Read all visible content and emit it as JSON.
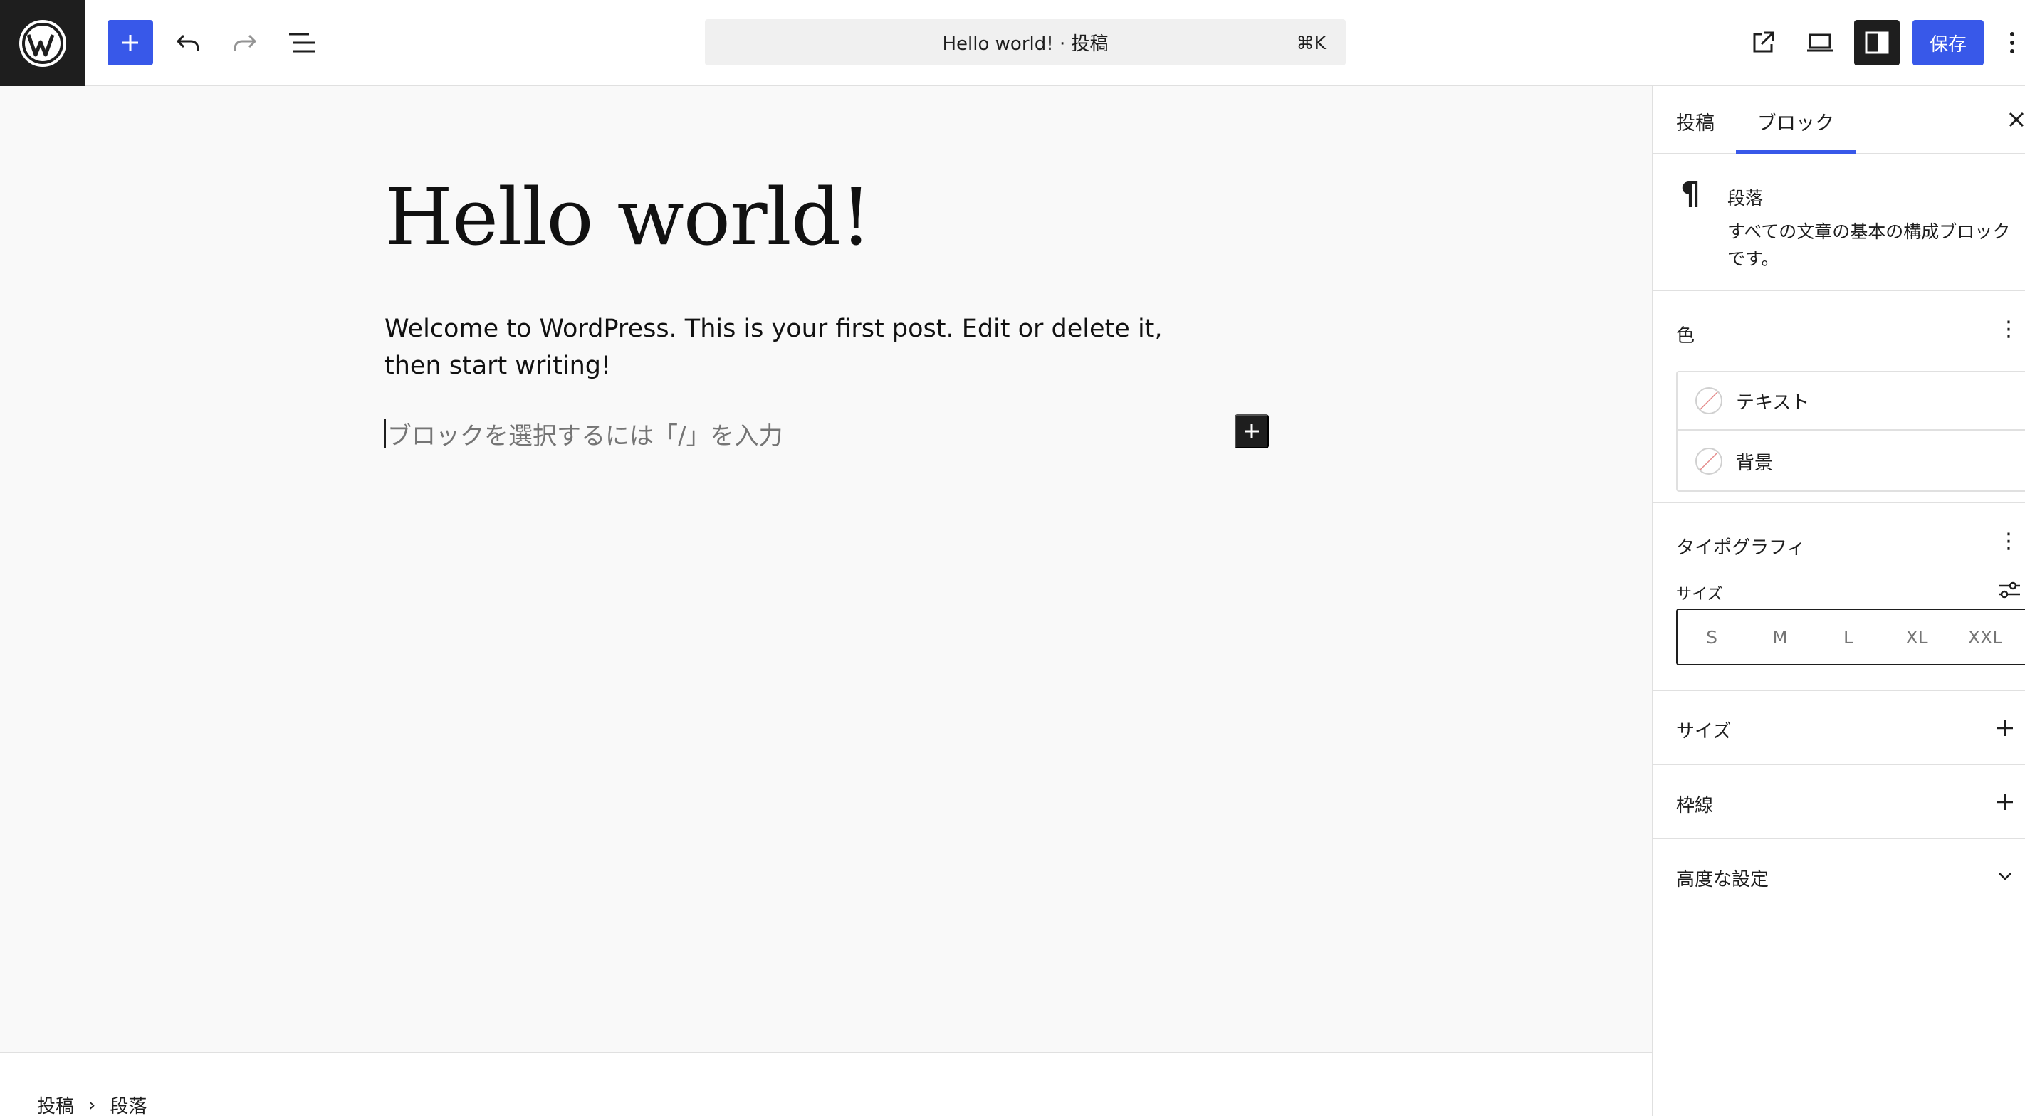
{
  "header": {
    "document_title": "Hello world! · 投稿",
    "shortcut": "⌘K",
    "save_label": "保存"
  },
  "editor": {
    "post_title": "Hello world!",
    "paragraph": "Welcome to WordPress. This is your first post. Edit or delete it, then start writing!",
    "placeholder": "ブロックを選択するには「/」を入力"
  },
  "footer": {
    "breadcrumbs": [
      "投稿",
      "段落"
    ]
  },
  "sidebar": {
    "tabs": [
      "投稿",
      "ブロック"
    ],
    "active_tab": "ブロック",
    "block": {
      "name": "段落",
      "description": "すべての文章の基本の構成ブロックです。"
    },
    "color": {
      "title": "色",
      "items": [
        "テキスト",
        "背景"
      ]
    },
    "typography": {
      "title": "タイポグラフィ",
      "size_label": "サイズ",
      "sizes": [
        "S",
        "M",
        "L",
        "XL",
        "XXL"
      ]
    },
    "panels": {
      "dimensions": "サイズ",
      "border": "枠線",
      "advanced": "高度な設定"
    }
  },
  "colors": {
    "accent": "#3858e9",
    "dark": "#1e1e1e",
    "canvas_bg": "#f9f9f9",
    "border": "#e0e0e0"
  }
}
